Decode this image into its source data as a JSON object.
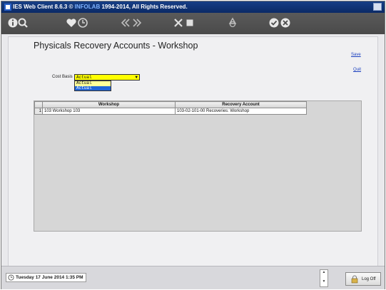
{
  "window": {
    "title_prefix": "IES Web Client 8.6.3 © ",
    "title_brand": "INFOLAB",
    "title_suffix": " 1994-2014, All Rights Reserved."
  },
  "toolbar": {
    "icons": [
      "info-icon",
      "search-icon",
      "favorite-icon",
      "history-icon",
      "prev-icon",
      "next-icon",
      "tools-icon",
      "stop-icon",
      "recycle-icon",
      "ok-icon",
      "cancel-icon"
    ]
  },
  "page": {
    "title": "Physicals Recovery Accounts - Workshop",
    "save_label": "Save",
    "quit_label": "Quit"
  },
  "cost_basis": {
    "label": "Cost Basis",
    "selected": "Actual",
    "options": [
      "Actual",
      "Actual"
    ]
  },
  "grid": {
    "columns": [
      "Workshop",
      "Recovery Account"
    ],
    "rows": [
      {
        "num": "1",
        "workshop": "103 Workshop 103",
        "account": "103-02-101-00 Recoveries: Workshop"
      }
    ]
  },
  "status": {
    "datetime": "Tuesday 17 June 2014 1:35 PM",
    "logoff_label": "Log Off"
  }
}
